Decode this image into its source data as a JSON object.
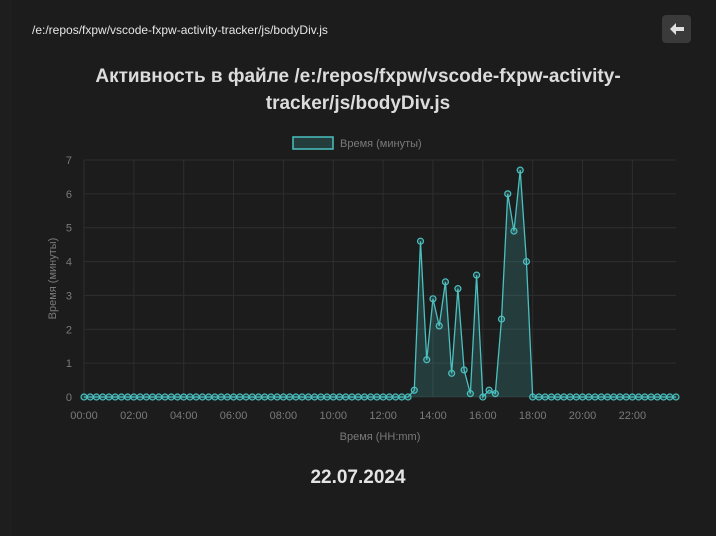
{
  "header": {
    "filepath": "/e:/repos/fxpw/vscode-fxpw-activity-tracker/js/bodyDiv.js",
    "back_icon": "arrow-left-icon"
  },
  "title": "Активность в файле /e:/repos/fxpw/vscode-fxpw-activity-tracker/js/bodyDiv.js",
  "date": "22.07.2024",
  "colors": {
    "line": "#4bc0c0",
    "fill": "rgba(75,192,192,0.2)",
    "grid": "#2e2e2e",
    "text": "#7a7a7a"
  },
  "chart_data": {
    "type": "line",
    "xlabel": "Время (HH:mm)",
    "ylabel": "Время (минуты)",
    "legend": {
      "label": "Время (минуты)",
      "position": "top"
    },
    "ylim": [
      0,
      7
    ],
    "yticks": [
      0,
      1,
      2,
      3,
      4,
      5,
      6,
      7
    ],
    "xticks": [
      "00:00",
      "02:00",
      "04:00",
      "06:00",
      "08:00",
      "10:00",
      "12:00",
      "14:00",
      "16:00",
      "18:00",
      "20:00",
      "22:00"
    ],
    "grid": true,
    "interval_minutes": 15,
    "series": [
      {
        "name": "Время (минуты)",
        "x": [
          "00:00",
          "00:15",
          "00:30",
          "00:45",
          "01:00",
          "01:15",
          "01:30",
          "01:45",
          "02:00",
          "02:15",
          "02:30",
          "02:45",
          "03:00",
          "03:15",
          "03:30",
          "03:45",
          "04:00",
          "04:15",
          "04:30",
          "04:45",
          "05:00",
          "05:15",
          "05:30",
          "05:45",
          "06:00",
          "06:15",
          "06:30",
          "06:45",
          "07:00",
          "07:15",
          "07:30",
          "07:45",
          "08:00",
          "08:15",
          "08:30",
          "08:45",
          "09:00",
          "09:15",
          "09:30",
          "09:45",
          "10:00",
          "10:15",
          "10:30",
          "10:45",
          "11:00",
          "11:15",
          "11:30",
          "11:45",
          "12:00",
          "12:15",
          "12:30",
          "12:45",
          "13:00",
          "13:15",
          "13:30",
          "13:45",
          "14:00",
          "14:15",
          "14:30",
          "14:45",
          "15:00",
          "15:15",
          "15:30",
          "15:45",
          "16:00",
          "16:15",
          "16:30",
          "16:45",
          "17:00",
          "17:15",
          "17:30",
          "17:45",
          "18:00",
          "18:15",
          "18:30",
          "18:45",
          "19:00",
          "19:15",
          "19:30",
          "19:45",
          "20:00",
          "20:15",
          "20:30",
          "20:45",
          "21:00",
          "21:15",
          "21:30",
          "21:45",
          "22:00",
          "22:15",
          "22:30",
          "22:45",
          "23:00",
          "23:15",
          "23:30",
          "23:45"
        ],
        "values": [
          0,
          0,
          0,
          0,
          0,
          0,
          0,
          0,
          0,
          0,
          0,
          0,
          0,
          0,
          0,
          0,
          0,
          0,
          0,
          0,
          0,
          0,
          0,
          0,
          0,
          0,
          0,
          0,
          0,
          0,
          0,
          0,
          0,
          0,
          0,
          0,
          0,
          0,
          0,
          0,
          0,
          0,
          0,
          0,
          0,
          0,
          0,
          0,
          0,
          0,
          0,
          0,
          0,
          0.2,
          4.6,
          1.1,
          2.9,
          2.1,
          3.4,
          0.7,
          3.2,
          0.8,
          0.1,
          3.6,
          0,
          0.2,
          0.1,
          2.3,
          6,
          4.9,
          6.7,
          4.0,
          0,
          0,
          0,
          0,
          0,
          0,
          0,
          0,
          0,
          0,
          0,
          0,
          0,
          0,
          0,
          0,
          0,
          0,
          0,
          0,
          0,
          0,
          0,
          0
        ]
      }
    ]
  }
}
